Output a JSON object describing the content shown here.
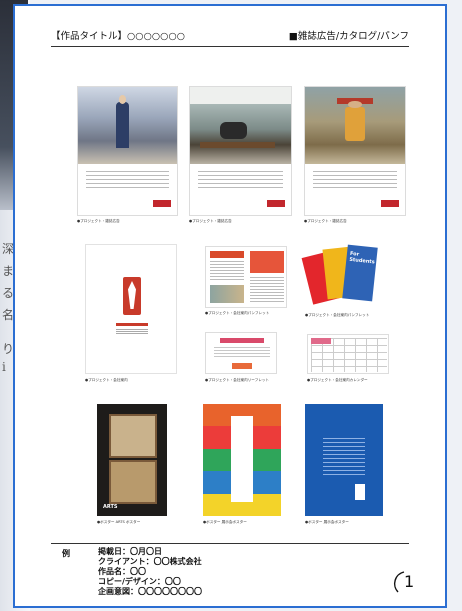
{
  "header": {
    "title": "【作品タイトル】○○○○○○○",
    "category": "■雑誌広告/カタログ/パンフ"
  },
  "background": {
    "glyphs": [
      "深",
      "ま",
      "る",
      "名",
      "り",
      "i"
    ]
  },
  "grid": {
    "row1": [
      {
        "caption": "●プロジェクト・雑誌広告"
      },
      {
        "caption": "●プロジェクト・雑誌広告"
      },
      {
        "caption": "●プロジェクト・雑誌広告"
      }
    ],
    "row2": [
      {
        "caption": "●プロジェクト・会社案内"
      },
      {
        "caption": "●プロジェクト・会社案内パンフレット"
      },
      {
        "caption": "●プロジェクト・会社案内パンフレット"
      }
    ],
    "row2b": [
      {
        "caption": "●プロジェクト・会社案内リーフレット"
      },
      {
        "caption": "●プロジェクト・会社案内カレンダー"
      }
    ],
    "row3": [
      {
        "caption": "●ポスター ARTS ポスター"
      },
      {
        "caption": "●ポスター 展示会ポスター"
      },
      {
        "caption": "●ポスター 展示会ポスター"
      }
    ],
    "for_students_text": "For Students",
    "arts_text": "ARTS"
  },
  "footer": {
    "example_label": "例",
    "credits": [
      "掲載日：〇月〇日",
      "クライアント：〇〇株式会社",
      "作品名：〇〇",
      "コピー/デザイン：〇〇",
      "企画意図：〇〇〇〇〇〇〇〇"
    ],
    "page_number": "1"
  },
  "colors": {
    "frame": "#2b6ed2",
    "accent_red": "#c2272d"
  }
}
